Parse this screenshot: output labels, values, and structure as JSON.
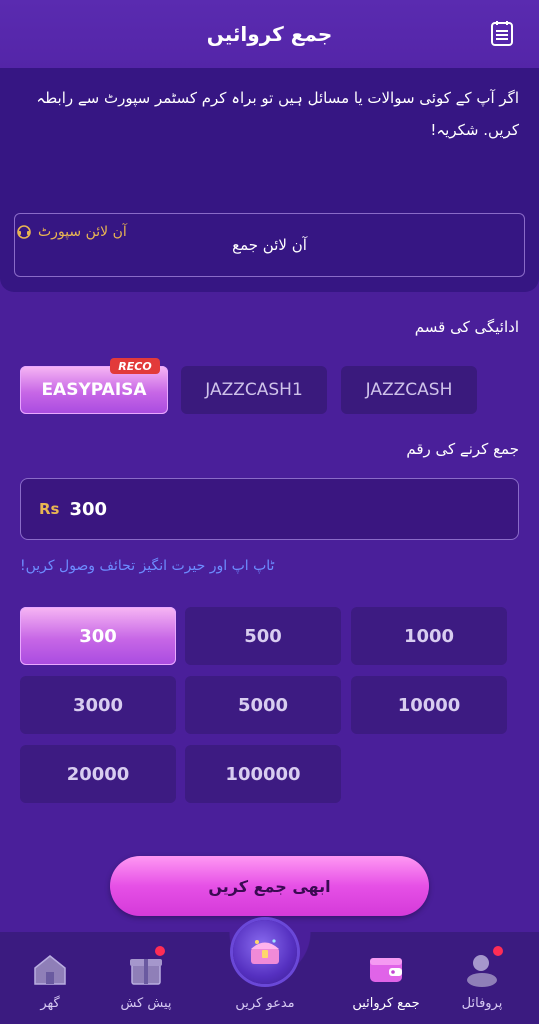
{
  "header": {
    "title": "جمع کروائیں",
    "menu_icon": "receipt-icon"
  },
  "notice": {
    "text": "اگر آپ کے کوئی سوالات یا مسائل ہیں تو براہ کرم کسٹمر سپورٹ سے رابطہ کریں. شکریہ!",
    "support_link": "آن لائن سپورٹ",
    "online_deposit_button": "آن لائن جمع"
  },
  "payment": {
    "label": "ادائیگی کی قسم",
    "methods": [
      {
        "label": "EASYPAISA",
        "badge": "RECO",
        "selected": true
      },
      {
        "label": "JAZZCASH1",
        "selected": false
      },
      {
        "label": "JAZZCASH",
        "selected": false
      }
    ]
  },
  "amount": {
    "label": "جمع کرنے کی رقم",
    "currency": "Rs",
    "value": "300",
    "promo": "!ٹاپ اپ اور حیرت انگیز تحائف وصول کریں",
    "options": [
      "300",
      "500",
      "1000",
      "3000",
      "5000",
      "10000",
      "20000",
      "100000"
    ],
    "selected": "300"
  },
  "submit_button": "ابھی جمع کریں",
  "tabs": [
    {
      "label": "گھر",
      "icon": "home-icon"
    },
    {
      "label": "پیش کش",
      "icon": "gift-icon",
      "dot": true
    },
    {
      "label": "مدعو کریں",
      "icon": "treasure-chest-icon"
    },
    {
      "label": "جمع کروائیں",
      "icon": "wallet-icon",
      "active": true
    },
    {
      "label": "پروفائل",
      "icon": "profile-icon",
      "dot": true
    }
  ],
  "colors": {
    "accent": "#d43ad9",
    "gold": "#e9b552",
    "link": "#6d8cff",
    "bg": "#4a1f9a"
  }
}
